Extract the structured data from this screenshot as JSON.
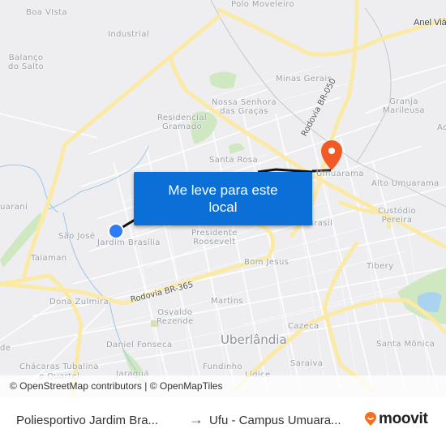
{
  "map": {
    "labels": {
      "boa_vista": "Boa VIsta",
      "industrial": "Industrial",
      "balanco_do_salto": "Balanço\ndo Salto",
      "polo_moveleiro": "Polo Moveleiro",
      "anel_viario": "Anel Viá",
      "minas_gerais": "Minas Gerais",
      "nossa_senhora": "Nossa Senhora\ndas Graças",
      "residencial_gramado": "Residencial\nGramado",
      "granja_marileusa": "Granja\nMarileusa",
      "ac": "Ac",
      "santa_rosa": "Santa Rosa",
      "umuarama": "Umuarama",
      "alto_umuarama": "Alto Umuarama",
      "guarani": "uarani",
      "sao_jose": "São José",
      "jardim_brasilia": "Jardim Brasília",
      "presidente_roosevelt": "Presidente\nRoosevelt",
      "brasil": "Brasil",
      "custodio_pereira": "Custódio\nPereira",
      "taiaman": "Taiaman",
      "bom_jesus": "Bom Jesus",
      "tibery": "Tibery",
      "dona_zulmira": "Dona Zulmira",
      "martins": "Martins",
      "osvaldo_rezende": "Osvaldo\nRezende",
      "uberlandia": "Uberlândia",
      "cazeca": "Cazeca",
      "de": "de",
      "daniel_fonseca": "Daniel Fonseca",
      "santa_monica": "Santa Mônica",
      "chacaras_tubalina": "Chácaras Tubalina",
      "e_quartel": "e Quartel",
      "jaragua": "Jaraguá",
      "fundinho": "Fundinho",
      "lidice": "Lídice",
      "saraiva": "Saraiva"
    },
    "roads": {
      "br050": "Rodovia BR-050",
      "br365": "Rodovia BR-365"
    },
    "origin_marker": "origin-dot",
    "destination_marker": "destination-pin",
    "colors": {
      "route": "#111111",
      "origin": "#2f7cf6",
      "destination": "#f15a24",
      "road": "#fbe9a6",
      "park": "#cfe8c1",
      "water": "#aad3f0"
    }
  },
  "cta": {
    "label": "Me leve para este local"
  },
  "attribution": "© OpenStreetMap contributors | © OpenMapTiles",
  "footer": {
    "origin": "Poliesportivo Jardim Bra...",
    "arrow": "→",
    "destination": "Ufu - Campus Umuara...",
    "brand": "moovit",
    "brand_color": "#f36f21"
  }
}
